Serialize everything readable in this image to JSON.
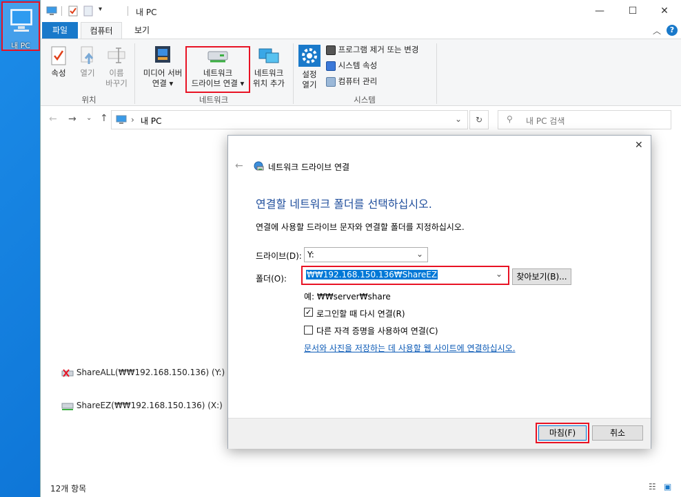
{
  "desktop": {
    "icon_label": "내 PC"
  },
  "window": {
    "title": "내 PC",
    "controls": {
      "minimize": "—",
      "maximize": "☐",
      "close": "✕"
    },
    "tabs": [
      "파일",
      "컴퓨터",
      "보기"
    ],
    "ribbon": {
      "location_group": {
        "label": "위치",
        "items": [
          "속성",
          "열기",
          "이름\n바꾸기"
        ]
      },
      "network_group": {
        "label": "네트워크",
        "items": [
          "미디어 서버\n연결 ▾",
          "네트워크\n드라이브 연결 ▾",
          "네트워크\n위치 추가"
        ]
      },
      "system_group": {
        "label": "시스템",
        "open_settings": "설정\n열기",
        "items": [
          "프로그램 제거 또는 변경",
          "시스템 속성",
          "컴퓨터 관리"
        ]
      }
    },
    "address": {
      "path": "내 PC",
      "search_placeholder": "내 PC 검색"
    },
    "drives": [
      {
        "label": "ShareALL(₩₩192.168.150.136) (Y:)",
        "status": "disconnected"
      },
      {
        "label": "ShareEZ(₩₩192.168.150.136) (X:)",
        "status": "connected"
      }
    ],
    "status": "12개 항목"
  },
  "dialog": {
    "title": "네트워크 드라이브 연결",
    "heading": "연결할 네트워크 폴더를 선택하십시오.",
    "description": "연결에 사용할 드라이브 문자와 연결할 폴더를 지정하십시오.",
    "drive_label": "드라이브(D):",
    "drive_value": "Y:",
    "folder_label": "폴더(O):",
    "folder_value": "₩₩192.168.150.136₩ShareEZ",
    "browse_label": "찾아보기(B)...",
    "example": "예: ₩₩server₩share",
    "reconnect_label": "로그인할 때 다시 연결(R)",
    "reconnect_checked": true,
    "other_credentials_label": "다른 자격 증명을 사용하여 연결(C)",
    "other_credentials_checked": false,
    "link_text": "문서와 사진을 저장하는 데 사용할 웹 사이트에 연결하십시오.",
    "finish_label": "마침(F)",
    "cancel_label": "취소"
  },
  "colors": {
    "accent": "#1979ca",
    "highlight_red": "#e81123",
    "heading_blue": "#1f4e9c",
    "selection": "#0078d7"
  }
}
